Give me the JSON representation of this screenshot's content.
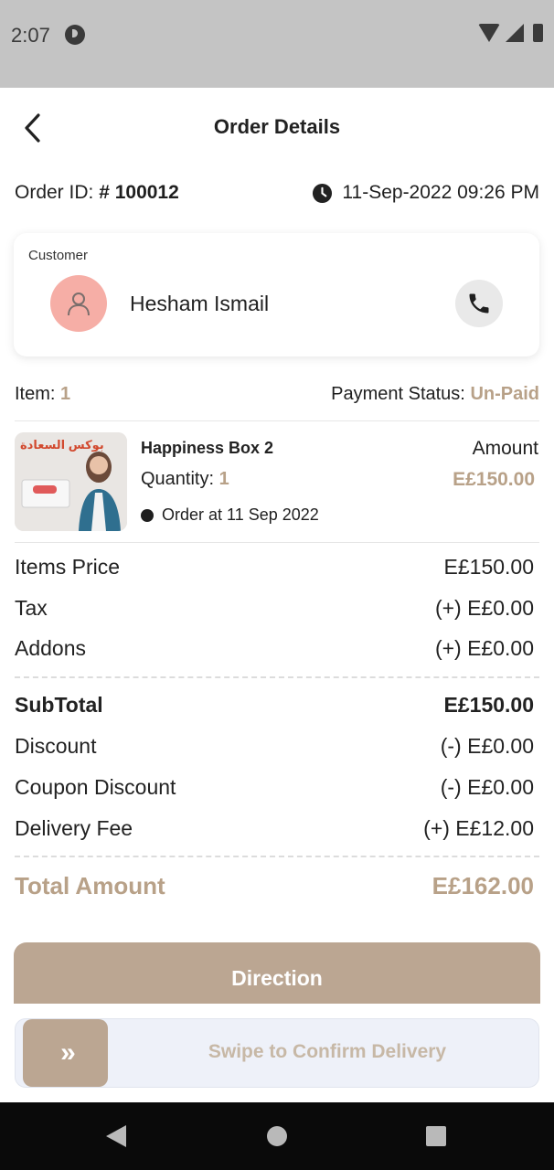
{
  "status_bar": {
    "time": "2:07"
  },
  "header": {
    "title": "Order Details"
  },
  "order": {
    "id_label": "Order ID:",
    "id_value": "# 100012",
    "datetime": "11-Sep-2022 09:26 PM"
  },
  "customer": {
    "label": "Customer",
    "name": "Hesham Ismail"
  },
  "summary": {
    "item_label": "Item:",
    "item_count": "1",
    "payment_label": "Payment Status:",
    "payment_value": "Un-Paid"
  },
  "item": {
    "name": "Happiness Box 2",
    "quantity_label": "Quantity:",
    "quantity_value": "1",
    "order_at": "Order at 11 Sep 2022",
    "amount_label": "Amount",
    "amount_value": "E£150.00",
    "image_caption": "بوكس السعادة"
  },
  "prices": {
    "items_price_label": "Items Price",
    "items_price_value": "E£150.00",
    "tax_label": "Tax",
    "tax_value": "(+) E£0.00",
    "addons_label": "Addons",
    "addons_value": "(+) E£0.00",
    "subtotal_label": "SubTotal",
    "subtotal_value": "E£150.00",
    "discount_label": "Discount",
    "discount_value": "(-) E£0.00",
    "coupon_label": "Coupon Discount",
    "coupon_value": "(-) E£0.00",
    "delivery_label": "Delivery Fee",
    "delivery_value": "(+) E£12.00",
    "total_label": "Total Amount",
    "total_value": "E£162.00"
  },
  "actions": {
    "direction_label": "Direction",
    "swipe_label": "Swipe to Confirm Delivery",
    "swipe_handle": "»"
  },
  "colors": {
    "accent": "#b8a188",
    "button": "#bba692",
    "avatar": "#f6aea6"
  },
  "icons": {
    "back": "arrow-back-icon",
    "clock": "clock-icon",
    "user": "user-icon",
    "phone": "phone-icon"
  }
}
